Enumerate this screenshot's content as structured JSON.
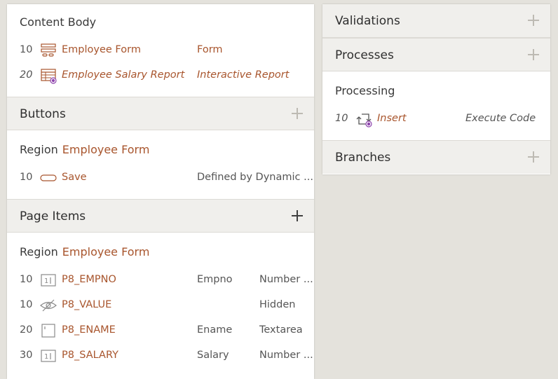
{
  "left": {
    "content_body": {
      "title": "Content Body",
      "rows": [
        {
          "seq": "10",
          "icon": "form-region-icon",
          "name": "Employee Form",
          "type": "Form"
        },
        {
          "seq": "20",
          "icon": "interactive-report-icon",
          "name": "Employee Salary Report",
          "type": "Interactive Report"
        }
      ]
    },
    "buttons": {
      "title": "Buttons",
      "region_prefix": "Region",
      "region_name": "Employee Form",
      "rows": [
        {
          "seq": "10",
          "icon": "button-icon",
          "name": "Save",
          "action": "Defined by Dynamic ..."
        }
      ]
    },
    "page_items": {
      "title": "Page Items",
      "region_prefix": "Region",
      "region_name": "Employee Form",
      "rows": [
        {
          "seq": "10",
          "icon": "number-field-icon",
          "name": "P8_EMPNO",
          "label": "Empno",
          "type": "Number ..."
        },
        {
          "seq": "10",
          "icon": "hidden-item-icon",
          "name": "P8_VALUE",
          "label": "",
          "type": "Hidden"
        },
        {
          "seq": "20",
          "icon": "textarea-icon",
          "name": "P8_ENAME",
          "label": "Ename",
          "type": "Textarea"
        },
        {
          "seq": "30",
          "icon": "number-field-icon",
          "name": "P8_SALARY",
          "label": "Salary",
          "type": "Number ..."
        }
      ]
    }
  },
  "right": {
    "validations": {
      "title": "Validations"
    },
    "processes": {
      "title": "Processes",
      "group": "Processing",
      "rows": [
        {
          "seq": "10",
          "icon": "process-icon",
          "name": "Insert",
          "type": "Execute Code"
        }
      ]
    },
    "branches": {
      "title": "Branches"
    }
  },
  "colors": {
    "accent": "#a8552d",
    "header_bg": "#f0efec",
    "page_bg": "#e4e2dc",
    "purple_badge": "#8e44ad"
  }
}
